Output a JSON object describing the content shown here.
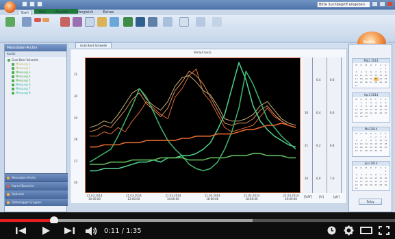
{
  "app": {
    "title_text": "",
    "title_box_text": "Bitte Suchbegriff eingeben",
    "menu_tabs": [
      "Start",
      "Edit",
      "Ansicht",
      "Vergleich",
      "Extras"
    ],
    "brand_text": "testo"
  },
  "navigation": {
    "header": "Messdaten-Archiv",
    "sub_header": "Archiv",
    "tree_items": [
      "Gute Beet Schwelle",
      "Messung 1",
      "Messung 2",
      "Messung 3",
      "Messung 4",
      "Messung 5",
      "Messung 6",
      "Messung 7",
      "Messung 8"
    ],
    "bottom_items": [
      "Messdaten-Archiv",
      "Alarm-Übersicht",
      "Optionen",
      "Datenlogger-Gruppen"
    ]
  },
  "document": {
    "tab_label": "Gute Beet Schwelle",
    "subtitle": "Verlauf (xxx)"
  },
  "chart_data": {
    "type": "line",
    "y_ticks": [
      "26",
      "27",
      "28",
      "29",
      "30",
      "31"
    ],
    "x_ticks": [
      [
        "21.03.2014",
        "10:00:00"
      ],
      [
        "21.03.2014",
        "12:00:00"
      ],
      [
        "21.03.2014",
        "14:00:00"
      ],
      [
        "21.03.2014",
        "16:00:00"
      ],
      [
        "21.03.2014",
        "18:00:00"
      ],
      [
        "21.03.2014",
        "20:00:00"
      ]
    ],
    "ylim": [
      25.6,
      31.8
    ],
    "series": [
      {
        "color": "#e0693a",
        "values": [
          28.2,
          28.2,
          28.4,
          28.3,
          28.6,
          28.4,
          28.9,
          29.3,
          29.8,
          29.5,
          29.2,
          29.0,
          30.0,
          30.4,
          31.0,
          31.3,
          30.2,
          29.8,
          29.2,
          28.6,
          28.4,
          28.5,
          28.6,
          28.7,
          29.1,
          29.5,
          29.1,
          28.9,
          28.7,
          28.6
        ]
      },
      {
        "color": "#c7b17a",
        "values": [
          28.6,
          28.7,
          28.9,
          28.8,
          29.2,
          29.7,
          30.2,
          30.4,
          29.9,
          29.6,
          29.4,
          29.8,
          30.5,
          30.9,
          31.0,
          30.7,
          30.3,
          30.1,
          29.6,
          29.0,
          28.9,
          28.9,
          29.0,
          29.2,
          29.6,
          29.8,
          29.4,
          29.0,
          28.8,
          28.7
        ]
      },
      {
        "color": "#d98f5c",
        "values": [
          28.4,
          28.5,
          28.7,
          28.6,
          29.0,
          29.4,
          29.9,
          30.2,
          29.7,
          29.4,
          29.1,
          29.5,
          30.3,
          30.7,
          31.2,
          31.0,
          30.6,
          30.0,
          29.4,
          28.8,
          28.7,
          28.8,
          28.8,
          29.0,
          29.4,
          29.6,
          29.2,
          28.9,
          28.7,
          28.6
        ]
      },
      {
        "color": "#3fae6a",
        "values": [
          27.0,
          27.2,
          27.4,
          27.6,
          28.2,
          28.9,
          29.6,
          30.4,
          30.0,
          29.3,
          28.6,
          28.0,
          27.6,
          27.3,
          26.9,
          26.7,
          26.6,
          26.7,
          27.0,
          27.6,
          28.4,
          29.5,
          31.2,
          30.6,
          29.8,
          29.0,
          28.6,
          28.2,
          27.9,
          27.6
        ]
      },
      {
        "color": "#4cc98a",
        "values": [
          26.6,
          26.6,
          26.7,
          26.7,
          26.7,
          26.8,
          26.9,
          27.0,
          27.0,
          27.1,
          27.0,
          27.2,
          27.2,
          27.3,
          27.3,
          27.4,
          27.6,
          27.9,
          28.5,
          29.2,
          30.4,
          31.6,
          30.8,
          29.6,
          28.9,
          28.5,
          28.2,
          28.0,
          27.8,
          27.7
        ]
      },
      {
        "color": "#e2682c",
        "values": [
          27.7,
          27.7,
          27.8,
          27.8,
          27.8,
          27.9,
          27.9,
          27.9,
          28.0,
          28.0,
          28.0,
          28.0,
          28.0,
          28.1,
          28.1,
          28.2,
          28.2,
          28.2,
          28.3,
          28.3,
          28.3,
          28.4,
          28.5,
          28.5,
          28.6,
          28.7,
          28.7,
          28.8,
          28.7,
          28.6
        ]
      },
      {
        "color": "#5fb85a",
        "values": [
          26.9,
          26.9,
          26.9,
          27.0,
          27.0,
          27.0,
          27.1,
          27.1,
          27.1,
          27.1,
          27.2,
          27.2,
          27.2,
          27.2,
          27.1,
          27.1,
          27.1,
          27.2,
          27.2,
          27.2,
          27.3,
          27.3,
          27.3,
          27.4,
          27.4,
          27.3,
          27.3,
          27.3,
          27.2,
          27.2
        ]
      }
    ],
    "right_axis_ticks": [
      [
        "0.4",
        "0.6"
      ],
      [
        "30",
        "6.4",
        "6.6"
      ],
      [
        "21",
        "6.2",
        "6.8"
      ],
      [
        "10",
        "6.0",
        "7.0"
      ]
    ],
    "right_axis_labels": [
      "[%RF]",
      "[%]",
      "[pH]"
    ]
  },
  "calendar": {
    "months": [
      "März 2014",
      "April 2014",
      "Mai 2014",
      "Juni 2014"
    ],
    "weekday_header": [
      "M",
      "D",
      "M",
      "D",
      "F",
      "S",
      "S"
    ],
    "today_label": "Today"
  },
  "player": {
    "progress_fraction": 0.137,
    "buffer_fraction": 0.64,
    "current_time": "0:11",
    "duration": "1:35",
    "time_display": "0:11 / 1:35"
  }
}
